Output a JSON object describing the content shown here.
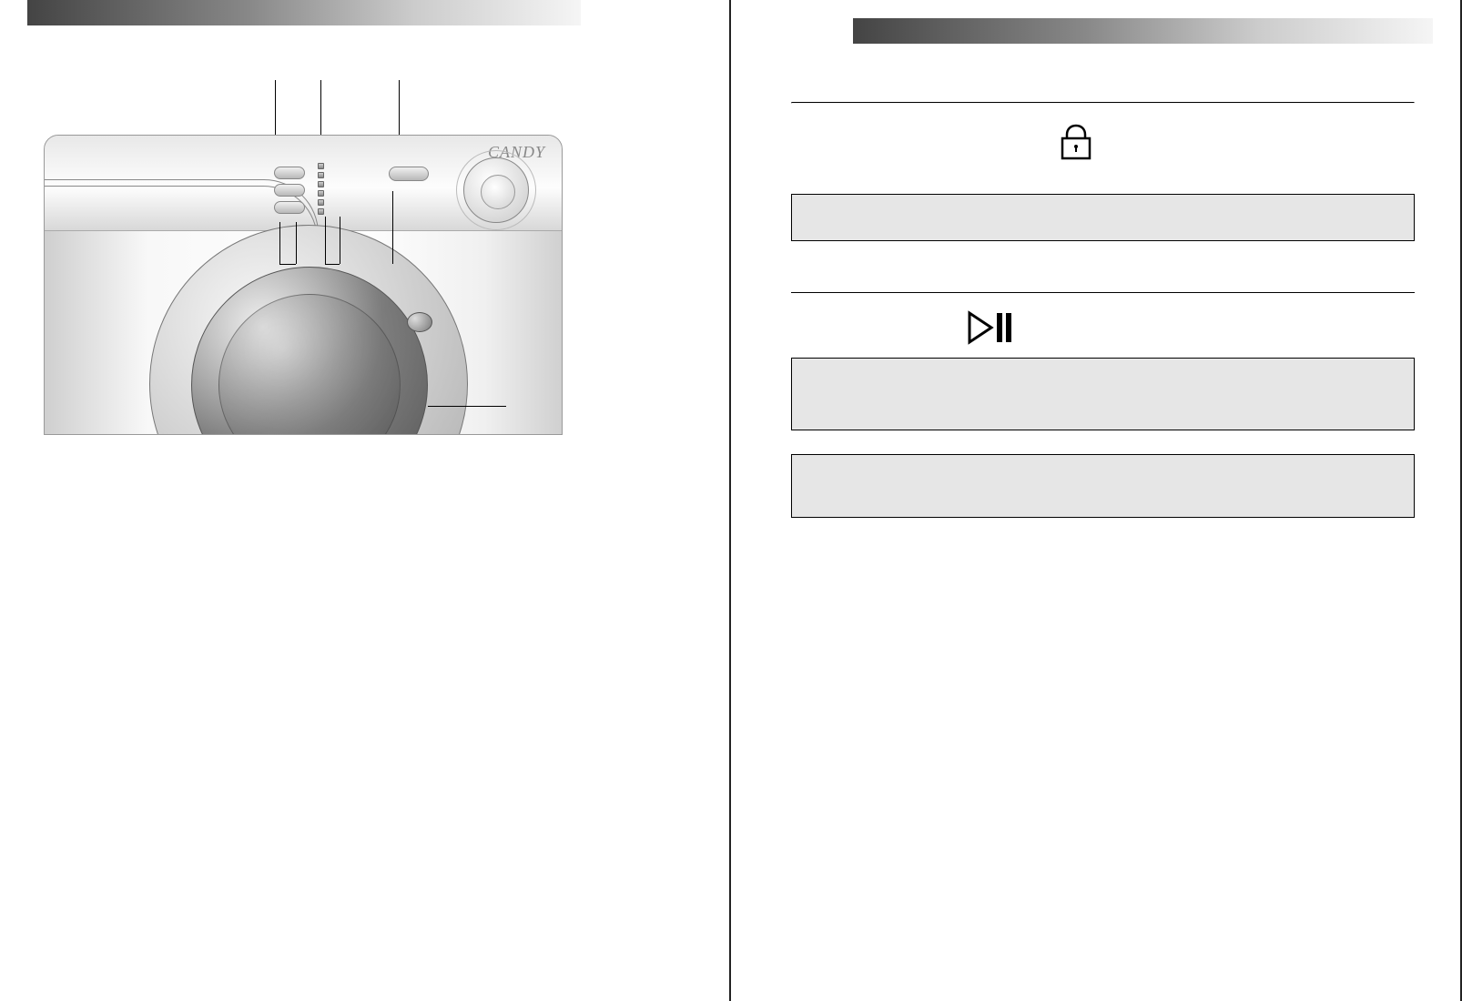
{
  "brand_label": "CANDY",
  "dial_numbers": [
    "",
    "",
    "",
    "",
    ""
  ],
  "icons": {
    "lock": "lock-icon",
    "play_pause": "play-pause-icon"
  }
}
